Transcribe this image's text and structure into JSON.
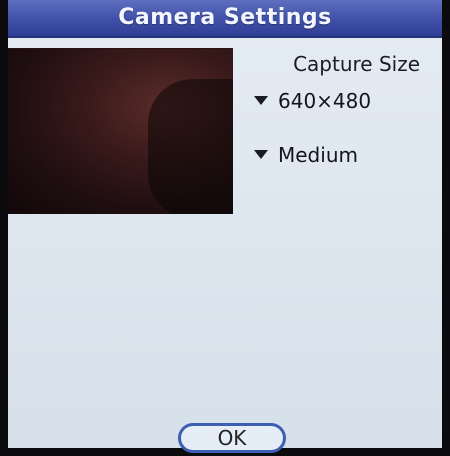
{
  "window": {
    "title": "Camera Settings"
  },
  "preview": {
    "icon": "camera-preview"
  },
  "capture": {
    "label": "Capture Size",
    "size_value": "640×480",
    "quality_value": "Medium"
  },
  "footer": {
    "ok_label": "OK"
  },
  "colors": {
    "title_bar": "#3f50a6",
    "background": "#dfe7f0",
    "ok_border": "#3c5fb3"
  }
}
